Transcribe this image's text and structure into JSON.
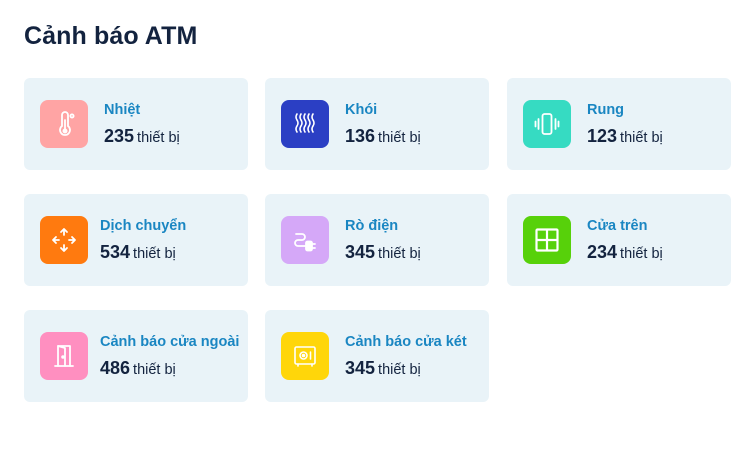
{
  "page": {
    "title": "Cảnh báo ATM"
  },
  "colors": {
    "card_bg": "#e9f3f8",
    "label": "#1a86c2",
    "text": "#13233f"
  },
  "cards": [
    {
      "label": "Nhiệt",
      "count": "235",
      "unit": "thiết bị",
      "icon": "thermometer-icon",
      "icon_bg": "#ffa4a4"
    },
    {
      "label": "Khói",
      "count": "136",
      "unit": "thiết bị",
      "icon": "smoke-icon",
      "icon_bg": "#2b3fc4"
    },
    {
      "label": "Rung",
      "count": "123",
      "unit": "thiết bị",
      "icon": "vibration-icon",
      "icon_bg": "#36dbc2"
    },
    {
      "label": "Dịch chuyển",
      "count": "534",
      "unit": "thiết bị",
      "icon": "move-icon",
      "icon_bg": "#ff7a0f"
    },
    {
      "label": "Rò điện",
      "count": "345",
      "unit": "thiết bị",
      "icon": "electric-plug-icon",
      "icon_bg": "#d5a8f8"
    },
    {
      "label": "Cửa trên",
      "count": "234",
      "unit": "thiết bị",
      "icon": "window-icon",
      "icon_bg": "#57d10a"
    },
    {
      "label": "Cảnh báo cửa ngoài",
      "count": "486",
      "unit": "thiết bị",
      "icon": "door-icon",
      "icon_bg": "#ff8fc0"
    },
    {
      "label": "Cảnh báo cửa két",
      "count": "345",
      "unit": "thiết bị",
      "icon": "safe-icon",
      "icon_bg": "#ffd60a"
    }
  ]
}
